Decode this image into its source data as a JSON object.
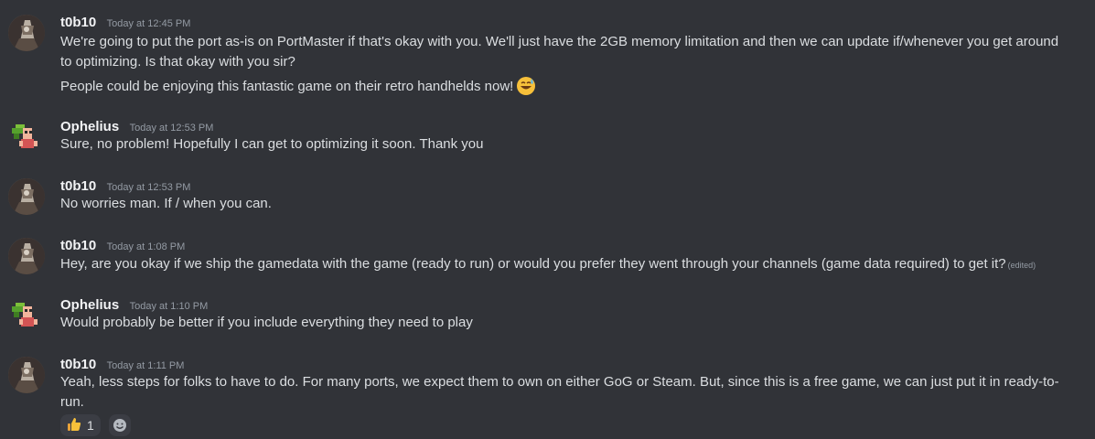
{
  "messages": [
    {
      "author": "t0b10",
      "timestamp": "Today at 12:45 PM",
      "lines": [
        "We're going to put the port as-is on PortMaster if that's okay with you. We'll just have the 2GB memory limitation and then we can update if/whenever you get around",
        "to optimizing. Is that okay with you sir?",
        "People could be enjoying this fantastic game on their retro handhelds now!"
      ],
      "emoji": "sweat-smile-emoji"
    },
    {
      "author": "Ophelius",
      "timestamp": "Today at 12:53 PM",
      "lines": [
        "Sure, no problem! Hopefully I can get to optimizing it soon. Thank you"
      ]
    },
    {
      "author": "t0b10",
      "timestamp": "Today at 12:53 PM",
      "lines": [
        "No worries man. If / when you can."
      ]
    },
    {
      "author": "t0b10",
      "timestamp": "Today at 1:08 PM",
      "lines": [
        "Hey, are you okay if we ship the gamedata with the game (ready to run) or would you prefer they went through your channels (game data required) to get it?"
      ],
      "edited": "(edited)"
    },
    {
      "author": "Ophelius",
      "timestamp": "Today at 1:10 PM",
      "lines": [
        "Would probably be better if you include everything they need to play"
      ]
    },
    {
      "author": "t0b10",
      "timestamp": "Today at 1:11 PM",
      "lines": [
        "Yeah, less steps for folks to have to do.  For many ports, we expect them to own on either GoG or Steam. But, since this is a free game, we can just put it in ready-to-",
        "run."
      ],
      "reactions": [
        {
          "icon": "thumbs-up-emoji",
          "count": "1"
        },
        {
          "icon": "add-reaction-icon"
        }
      ]
    }
  ],
  "colors": {
    "background": "#313338",
    "author": "#f2f3f5",
    "text": "#dbdee1",
    "muted": "#949ba4",
    "reaction_bg": "#3b3d44"
  }
}
